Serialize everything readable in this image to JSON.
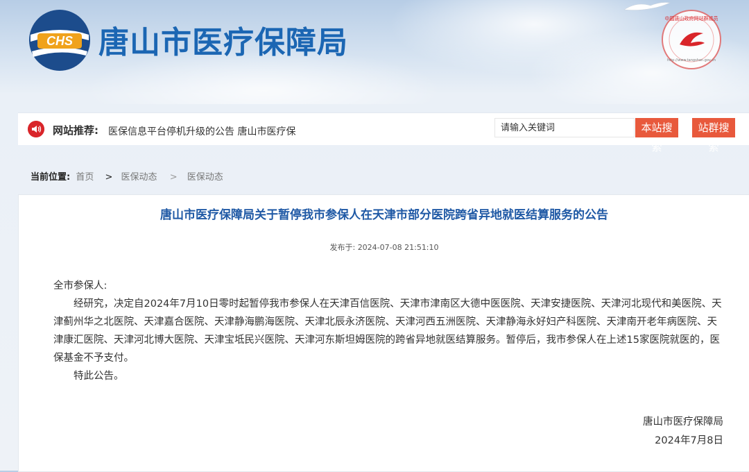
{
  "header": {
    "logo_text": "CHS",
    "title": "唐山市医疗保障局",
    "seal_text": "中国唐山政府网站群成员",
    "seal_url": "http://www.tangshan.gov.cn"
  },
  "recommend": {
    "label": "网站推荐:",
    "marquee": "医保信息平台停机升级的公告 唐山市医疗保",
    "search_placeholder": "请输入关键词",
    "site_search": "本站搜索",
    "group_search": "站群搜索"
  },
  "breadcrumb": {
    "label": "当前位置:",
    "items": [
      "首页",
      ">",
      "医保动态",
      ">",
      "医保动态"
    ]
  },
  "article": {
    "title": "唐山市医疗保障局关于暂停我市参保人在天津市部分医院跨省异地就医结算服务的公告",
    "publish_label": "发布于:",
    "publish_time": "2024-07-08 21:51:10",
    "salutation": "全市参保人:",
    "paragraph1": "经研究，决定自2024年7月10日零时起暂停我市参保人在天津百信医院、天津市津南区大德中医医院、天津安捷医院、天津河北现代和美医院、天津蓟州华之北医院、天津嘉合医院、天津静海鹏海医院、天津北辰永济医院、天津河西五洲医院、天津静海永好妇产科医院、天津南开老年病医院、天津康汇医院、天津河北博大医院、天津宝坻民兴医院、天津河东斯坦姆医院的跨省异地就医结算服务。暂停后，我市参保人在上述15家医院就医的，医保基金不予支付。",
    "closing": "特此公告。",
    "signature": "唐山市医疗保障局",
    "date": "2024年7月8日"
  },
  "colors": {
    "title_blue": "#1b66b3",
    "article_title": "#1f59a5",
    "button": "#e8593c",
    "rec_icon": "#d9252a"
  }
}
